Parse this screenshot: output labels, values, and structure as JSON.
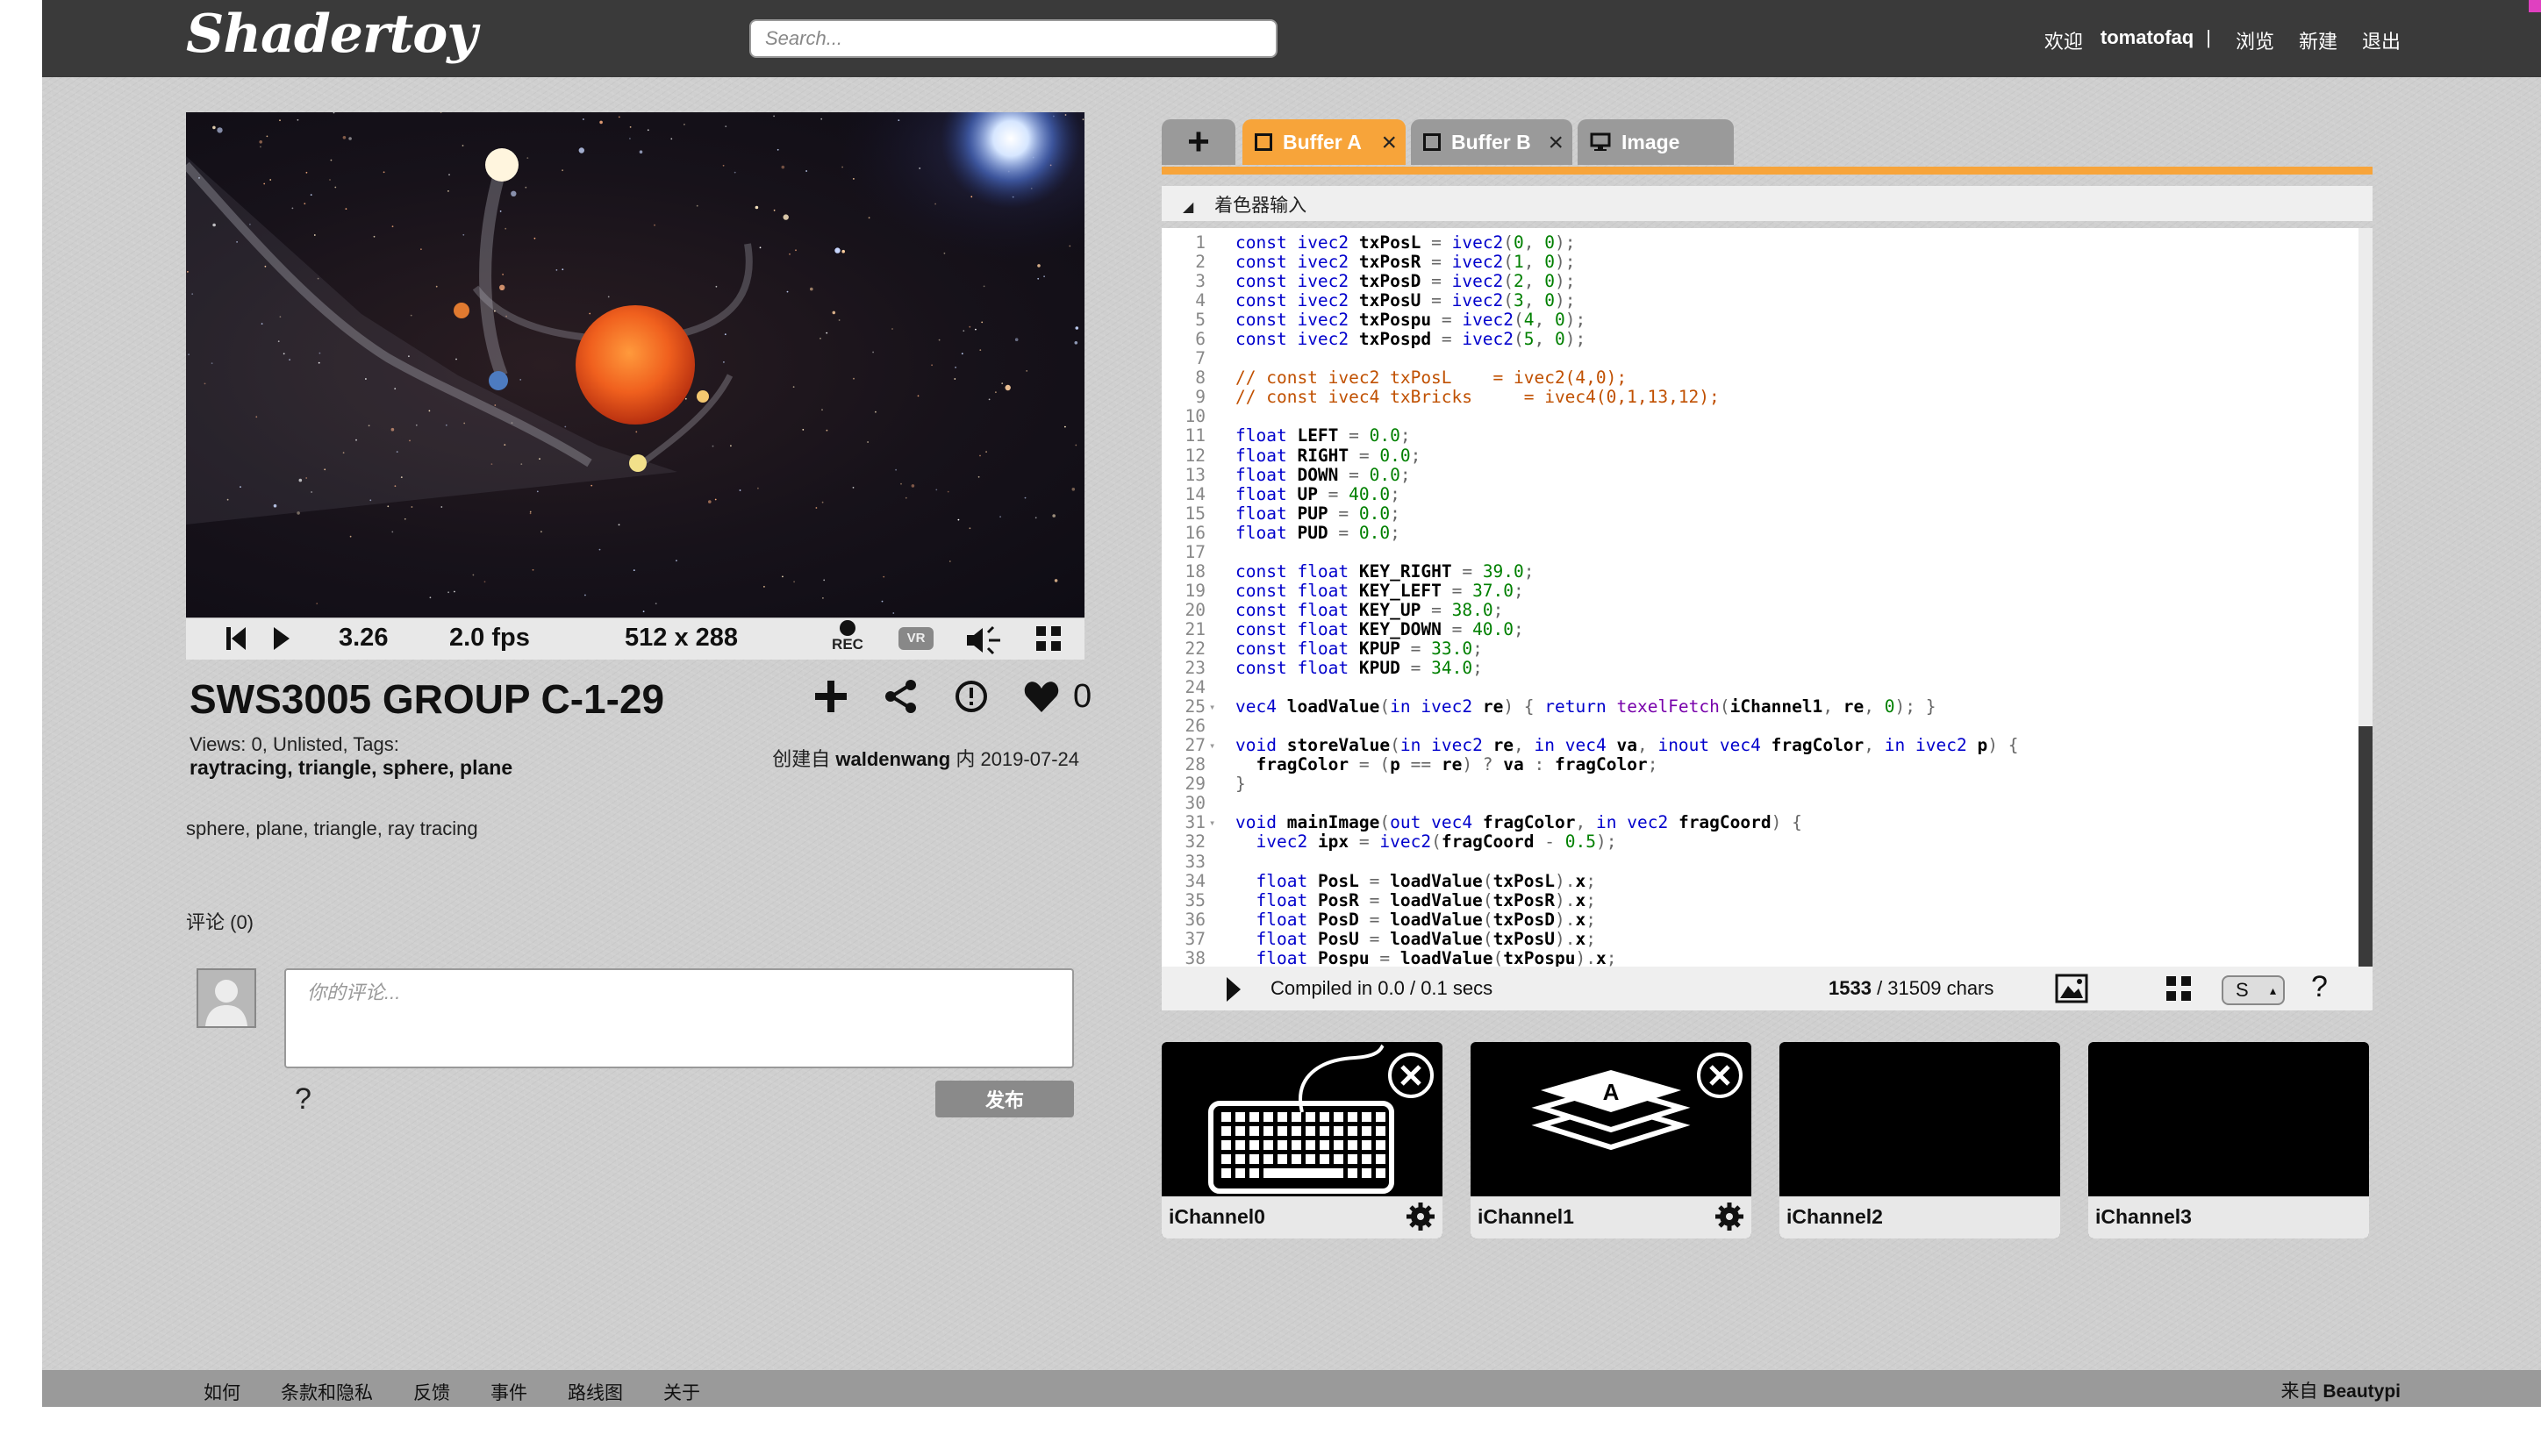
{
  "header": {
    "logo": "Shadertoy",
    "search_placeholder": "Search...",
    "nav": {
      "welcome": "欢迎",
      "user": "tomatofaq",
      "sep": "|",
      "browse": "浏览",
      "new": "新建",
      "logout": "退出"
    }
  },
  "player": {
    "time": "3.26",
    "fps": "2.0 fps",
    "resolution": "512 x 288",
    "rec_label": "REC",
    "vr_label": "VR"
  },
  "shader": {
    "title": "SWS3005 GROUP C-1-29",
    "likes": "0",
    "views_line": "Views: 0, Unlisted, Tags:",
    "tags_line": "raytracing, triangle, sphere, plane",
    "created_prefix": "创建自",
    "author": "waldenwang",
    "created_mid": "内",
    "date": "2019-07-24",
    "description": "sphere, plane, triangle, ray tracing"
  },
  "comments": {
    "label": "评论 (0)",
    "placeholder": "你的评论...",
    "help": "?",
    "post": "发布"
  },
  "editor": {
    "tabs": [
      {
        "label": "Buffer A",
        "active": true
      },
      {
        "label": "Buffer B",
        "active": false
      },
      {
        "label": "Image",
        "active": false
      }
    ],
    "add_tab": "+",
    "inputs_label": "着色器输入",
    "compile_text": "Compiled in 0.0 / 0.1 secs",
    "chars_count": "1533",
    "chars_total": " / 31509 chars",
    "select_value": "S",
    "help": "?",
    "accent_color": "#f7a43a"
  },
  "code_lines": [
    "const ivec2 txPosL = ivec2(0, 0);",
    "const ivec2 txPosR = ivec2(1, 0);",
    "const ivec2 txPosD = ivec2(2, 0);",
    "const ivec2 txPosU = ivec2(3, 0);",
    "const ivec2 txPospu = ivec2(4, 0);",
    "const ivec2 txPospd = ivec2(5, 0);",
    "",
    "// const ivec2 txPosL    = ivec2(4,0);",
    "// const ivec4 txBricks     = ivec4(0,1,13,12);",
    "",
    "float LEFT = 0.0;",
    "float RIGHT = 0.0;",
    "float DOWN = 0.0;",
    "float UP = 40.0;",
    "float PUP = 0.0;",
    "float PUD = 0.0;",
    "",
    "const float KEY_RIGHT = 39.0;",
    "const float KEY_LEFT = 37.0;",
    "const float KEY_UP = 38.0;",
    "const float KEY_DOWN = 40.0;",
    "const float KPUP = 33.0;",
    "const float KPUD = 34.0;",
    "",
    "vec4 loadValue(in ivec2 re) { return texelFetch(iChannel1, re, 0); }",
    "",
    "void storeValue(in ivec2 re, in vec4 va, inout vec4 fragColor, in ivec2 p) {",
    "  fragColor = (p == re) ? va : fragColor;",
    "}",
    "",
    "void mainImage(out vec4 fragColor, in vec2 fragCoord) {",
    "  ivec2 ipx = ivec2(fragCoord - 0.5);",
    "",
    "  float PosL = loadValue(txPosL).x;",
    "  float PosR = loadValue(txPosR).x;",
    "  float PosD = loadValue(txPosD).x;",
    "  float PosU = loadValue(txPosU).x;",
    "  float Pospu = loadValue(txPospu).x;"
  ],
  "fold_lines": [
    25,
    27,
    31
  ],
  "channels": [
    {
      "label": "iChannel0",
      "icon": "keyboard-icon",
      "has_content": true
    },
    {
      "label": "iChannel1",
      "icon": "buffer-stack-icon",
      "has_content": true,
      "letter": "A"
    },
    {
      "label": "iChannel2",
      "has_content": false
    },
    {
      "label": "iChannel3",
      "has_content": false
    }
  ],
  "footer": {
    "links": [
      "如何",
      "条款和隐私",
      "反馈",
      "事件",
      "路线图",
      "关于"
    ],
    "credit_prefix": "来自",
    "credit_name": "Beautypi"
  }
}
